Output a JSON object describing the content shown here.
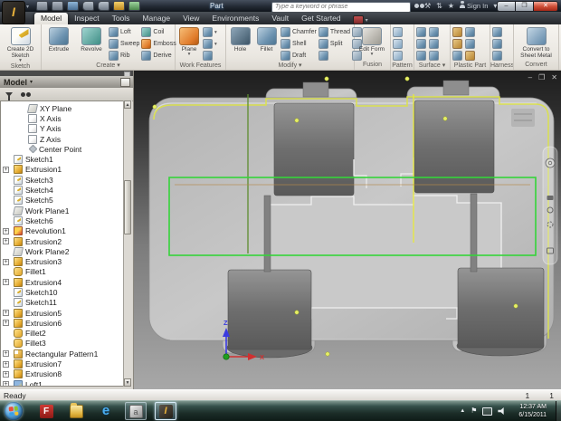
{
  "titlebar": {
    "title": "Part",
    "search_placeholder": "Type a keyword or phrase",
    "sign_in_label": "Sign In",
    "help_label": "?",
    "qat": [
      "new-file",
      "open",
      "save",
      "undo",
      "redo",
      "iproperties",
      "parameters"
    ]
  },
  "tabs": {
    "items": [
      {
        "label": "Model",
        "cls": "active"
      },
      {
        "label": "Inspect"
      },
      {
        "label": "Tools"
      },
      {
        "label": "Manage"
      },
      {
        "label": "View"
      },
      {
        "label": "Environments"
      },
      {
        "label": "Vault"
      },
      {
        "label": "Get Started"
      }
    ]
  },
  "ribbon": {
    "sketch": {
      "label": "Sketch",
      "big": [
        {
          "label": "Create 2D Sketch",
          "icon": "sketch",
          "caret": true
        }
      ]
    },
    "create": {
      "label": "Create ▾",
      "big": [
        {
          "label": "Extrude",
          "icon": "extrude"
        },
        {
          "label": "Revolve",
          "icon": "revolve"
        }
      ],
      "smalls": [
        {
          "label": "Loft",
          "icon": "loft"
        },
        {
          "label": "Sweep",
          "icon": "sweep"
        },
        {
          "label": "Rib",
          "icon": "rib"
        },
        {
          "label": "Coil",
          "icon": "coil"
        },
        {
          "label": "Emboss",
          "icon": "emboss"
        },
        {
          "label": "Derive",
          "icon": "derive"
        }
      ]
    },
    "work_features": {
      "label": "Work Features",
      "big": [
        {
          "label": "Plane",
          "icon": "plane",
          "caret": true
        }
      ],
      "smalls": [
        {
          "label": "",
          "icon": "axis",
          "caret": true
        },
        {
          "label": "",
          "icon": "point",
          "caret": true
        },
        {
          "label": "",
          "icon": "ucs"
        }
      ]
    },
    "modify": {
      "label": "Modify ▾",
      "big": [
        {
          "label": "Hole",
          "icon": "hole"
        },
        {
          "label": "Fillet",
          "icon": "fillet"
        }
      ],
      "smalls": [
        {
          "label": "Chamfer",
          "icon": "chamfer"
        },
        {
          "label": "Shell",
          "icon": "shell"
        },
        {
          "label": "Draft",
          "icon": "draft"
        },
        {
          "label": "Thread",
          "icon": "thread"
        },
        {
          "label": "Split",
          "icon": "split"
        },
        {
          "label": "",
          "icon": "combine"
        }
      ],
      "tools": [
        "move-face",
        "copy-object",
        "delete-face"
      ]
    },
    "fusion": {
      "label": "Fusion",
      "big": [
        {
          "label": "Edit Form",
          "icon": "edit-form",
          "caret": true
        }
      ]
    },
    "pattern": {
      "label": "Pattern",
      "stack": [
        "rectangular-pattern",
        "circular-pattern",
        "mirror"
      ]
    },
    "surface": {
      "label": "Surface ▾",
      "grid": [
        "sculpt",
        "patch",
        "trim",
        "extend",
        "boundary",
        "replace-face"
      ]
    },
    "plastic_part": {
      "label": "Plastic Part",
      "grid": [
        "grill",
        "boss",
        "rest",
        "snap-fit",
        "lip",
        "rule-fillet"
      ]
    },
    "harness": {
      "label": "Harness",
      "stack": [
        "harness-segment",
        "create-pin",
        "route-wire"
      ]
    },
    "convert": {
      "label": "Convert",
      "big": [
        {
          "label": "Convert to Sheet Metal",
          "icon": "sheet-metal"
        }
      ]
    }
  },
  "browser": {
    "header": "Model",
    "tree": [
      {
        "label": "XY Plane",
        "icon": "workplane",
        "ind": "i2"
      },
      {
        "label": "X Axis",
        "icon": "axis",
        "ind": "i2"
      },
      {
        "label": "Y Axis",
        "icon": "axis",
        "ind": "i2"
      },
      {
        "label": "Z Axis",
        "icon": "axis",
        "ind": "i2"
      },
      {
        "label": "Center Point",
        "icon": "point",
        "ind": "i2"
      },
      {
        "label": "Sketch1",
        "icon": "sketch",
        "ind": "i1"
      },
      {
        "label": "Extrusion1",
        "icon": "extrusion",
        "ind": "i1",
        "plus": true
      },
      {
        "label": "Sketch3",
        "icon": "sketch",
        "ind": "i1"
      },
      {
        "label": "Sketch4",
        "icon": "sketch",
        "ind": "i1"
      },
      {
        "label": "Sketch5",
        "icon": "sketch",
        "ind": "i1"
      },
      {
        "label": "Work Plane1",
        "icon": "workplane",
        "ind": "i1"
      },
      {
        "label": "Sketch6",
        "icon": "sketch",
        "ind": "i1"
      },
      {
        "label": "Revolution1",
        "icon": "revolution",
        "ind": "i1",
        "plus": true
      },
      {
        "label": "Extrusion2",
        "icon": "extrusion",
        "ind": "i1",
        "plus": true
      },
      {
        "label": "Work Plane2",
        "icon": "workplane",
        "ind": "i1"
      },
      {
        "label": "Extrusion3",
        "icon": "extrusion",
        "ind": "i1",
        "plus": true
      },
      {
        "label": "Fillet1",
        "icon": "fillet",
        "ind": "i1"
      },
      {
        "label": "Extrusion4",
        "icon": "extrusion",
        "ind": "i1",
        "plus": true
      },
      {
        "label": "Sketch10",
        "icon": "sketch",
        "ind": "i1"
      },
      {
        "label": "Sketch11",
        "icon": "sketch",
        "ind": "i1"
      },
      {
        "label": "Extrusion5",
        "icon": "extrusion",
        "ind": "i1",
        "plus": true
      },
      {
        "label": "Extrusion6",
        "icon": "extrusion",
        "ind": "i1",
        "plus": true
      },
      {
        "label": "Fillet2",
        "icon": "fillet",
        "ind": "i1"
      },
      {
        "label": "Fillet3",
        "icon": "fillet",
        "ind": "i1"
      },
      {
        "label": "Rectangular Pattern1",
        "icon": "pattern",
        "ind": "i1",
        "plus": true
      },
      {
        "label": "Extrusion7",
        "icon": "extrusion",
        "ind": "i1",
        "plus": true
      },
      {
        "label": "Extrusion8",
        "icon": "extrusion",
        "ind": "i1",
        "plus": true
      },
      {
        "label": "Loft1",
        "icon": "loft",
        "ind": "i1",
        "plus": true
      }
    ]
  },
  "viewport": {
    "triad_z": "Z",
    "triad_x": "X",
    "controls": {
      "minimize": "–",
      "restore": "❐",
      "close": "✕"
    }
  },
  "statusbar": {
    "left": "Ready",
    "count1": "1",
    "count2": "1"
  },
  "taskbar": {
    "apps": [
      {
        "icon": "flash-app",
        "glyph": "F",
        "frame": ""
      },
      {
        "icon": "explorer",
        "glyph": "",
        "frame": ""
      },
      {
        "icon": "ie",
        "glyph": "e",
        "frame": ""
      },
      {
        "icon": "autodesk-app",
        "glyph": "a",
        "frame": "framed"
      },
      {
        "icon": "inventor",
        "glyph": "I",
        "frame": "active"
      }
    ],
    "tray": [
      "hidden-icons",
      "action-center",
      "network",
      "volume"
    ],
    "clock_time": "12:37 AM",
    "clock_date": "6/15/2011"
  },
  "colors": {
    "sketch_green": "#35d43a",
    "sketch_yellow": "#dbe24a",
    "highlight_edge": "#f0f0f0",
    "triad_z_blue": "#3a3ae0",
    "triad_x_red": "#d03030"
  }
}
